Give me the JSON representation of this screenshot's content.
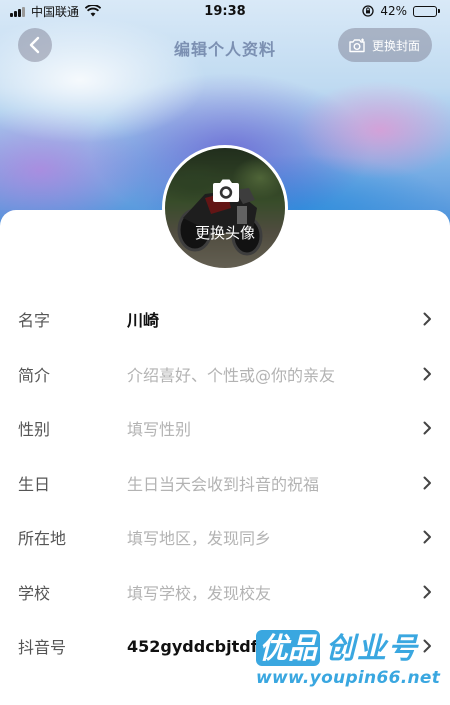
{
  "status_bar": {
    "carrier": "中国联通",
    "time": "19:38",
    "battery_percent": "42%",
    "battery_level": 0.42,
    "icons": [
      "signal-icon",
      "wifi-icon",
      "orientation-lock-icon",
      "battery-icon"
    ]
  },
  "header": {
    "title": "编辑个人资料",
    "back_icon": "chevron-left-icon",
    "change_cover_label": "更换封面",
    "change_cover_icon": "camera-icon"
  },
  "avatar": {
    "change_label": "更换头像",
    "camera_icon": "camera-icon"
  },
  "form": {
    "rows": [
      {
        "label": "名字",
        "value": "川崎",
        "filled": true
      },
      {
        "label": "简介",
        "value": "介绍喜好、个性或@你的亲友",
        "filled": false
      },
      {
        "label": "性别",
        "value": "填写性别",
        "filled": false
      },
      {
        "label": "生日",
        "value": "生日当天会收到抖音的祝福",
        "filled": false
      },
      {
        "label": "所在地",
        "value": "填写地区，发现同乡",
        "filled": false
      },
      {
        "label": "学校",
        "value": "填写学校，发现校友",
        "filled": false
      },
      {
        "label": "抖音号",
        "value": "452gyddcbjtdfhj",
        "filled": true
      }
    ]
  },
  "watermark": {
    "brand_boxed": "优品",
    "brand_rest": "创业号",
    "url": "www.youpin66.net"
  },
  "colors": {
    "accent_watermark": "#3aa7e0",
    "value_text": "#111111",
    "placeholder_text": "#b3b3b3",
    "label_text": "#555555"
  }
}
